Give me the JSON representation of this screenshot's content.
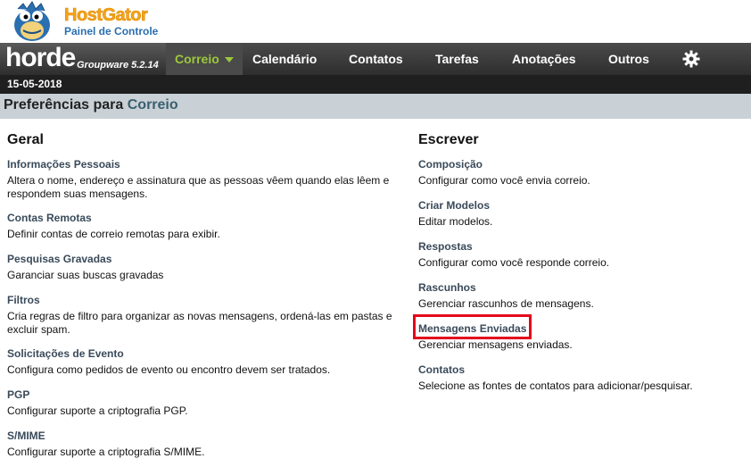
{
  "brand": {
    "name": "HostGator",
    "subtitle": "Painel de Controle"
  },
  "navbar": {
    "logo": "horde",
    "version": "Groupware 5.2.14",
    "menus": [
      {
        "label": "Correio",
        "active": true
      },
      {
        "label": "Calendário",
        "active": false
      },
      {
        "label": "Contatos",
        "active": false
      },
      {
        "label": "Tarefas",
        "active": false
      },
      {
        "label": "Anotações",
        "active": false
      },
      {
        "label": "Outros",
        "active": false
      }
    ],
    "settings_icon": "gear-icon"
  },
  "date": "15-05-2018",
  "prefs": {
    "prefix": "Preferências para ",
    "app": "Correio"
  },
  "left": {
    "heading": "Geral",
    "items": [
      {
        "title": "Informações Pessoais",
        "desc": "Altera o nome, endereço e assinatura que as pessoas vêem quando elas lêem e respondem suas mensagens."
      },
      {
        "title": "Contas Remotas",
        "desc": "Definir contas de correio remotas para exibir."
      },
      {
        "title": "Pesquisas Gravadas",
        "desc": "Garanciar suas buscas gravadas"
      },
      {
        "title": "Filtros",
        "desc": "Cria regras de filtro para organizar as novas mensagens, ordená-las em pastas e excluir spam."
      },
      {
        "title": "Solicitações de Evento",
        "desc": "Configura como pedidos de evento ou encontro devem ser tratados."
      },
      {
        "title": "PGP",
        "desc": "Configurar suporte a criptografia PGP."
      },
      {
        "title": "S/MIME",
        "desc": "Configurar suporte a criptografia S/MIME."
      }
    ]
  },
  "right": {
    "heading": "Escrever",
    "items": [
      {
        "title": "Composição",
        "desc": "Configurar como você envia correio."
      },
      {
        "title": "Criar Modelos",
        "desc": "Editar modelos."
      },
      {
        "title": "Respostas",
        "desc": "Configurar como você responde correio."
      },
      {
        "title": "Rascunhos",
        "desc": "Gerenciar rascunhos de mensagens."
      },
      {
        "title": "Mensagens Enviadas",
        "desc": "Gerenciar mensagens enviadas."
      },
      {
        "title": "Contatos",
        "desc": "Selecione as fontes de contatos para adicionar/pesquisar."
      }
    ]
  },
  "colors": {
    "highlight": "#e3071b",
    "active_menu": "#9cc83a",
    "pref_bar": "#c9d1d6"
  }
}
